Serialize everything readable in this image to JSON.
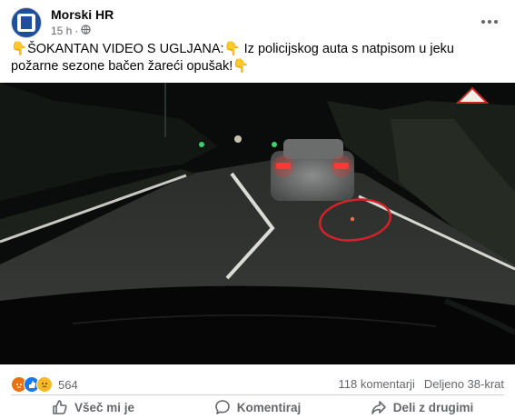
{
  "post": {
    "page_name": "Morski HR",
    "time": "15 h",
    "dot": "·",
    "privacy_icon": "globe-icon",
    "text_line1": "ŠOKANTAN VIDEO S UGLJANA:",
    "text_line1b": "Iz policijskog auta s natpisom u jeku požarne sezone bačen",
    "text_line2": "žareći opušak!",
    "emoji": "👇"
  },
  "engagement": {
    "reaction_count": "564",
    "comments": "118 komentarji",
    "shares": "Deljeno 38-krat"
  },
  "actions": {
    "like": "Všeč mi je",
    "comment": "Komentiraj",
    "share": "Deli z drugimi"
  },
  "colors": {
    "brand_blue": "#1877f2",
    "muted_text": "#65676b",
    "annotation_red": "#d0232a"
  }
}
